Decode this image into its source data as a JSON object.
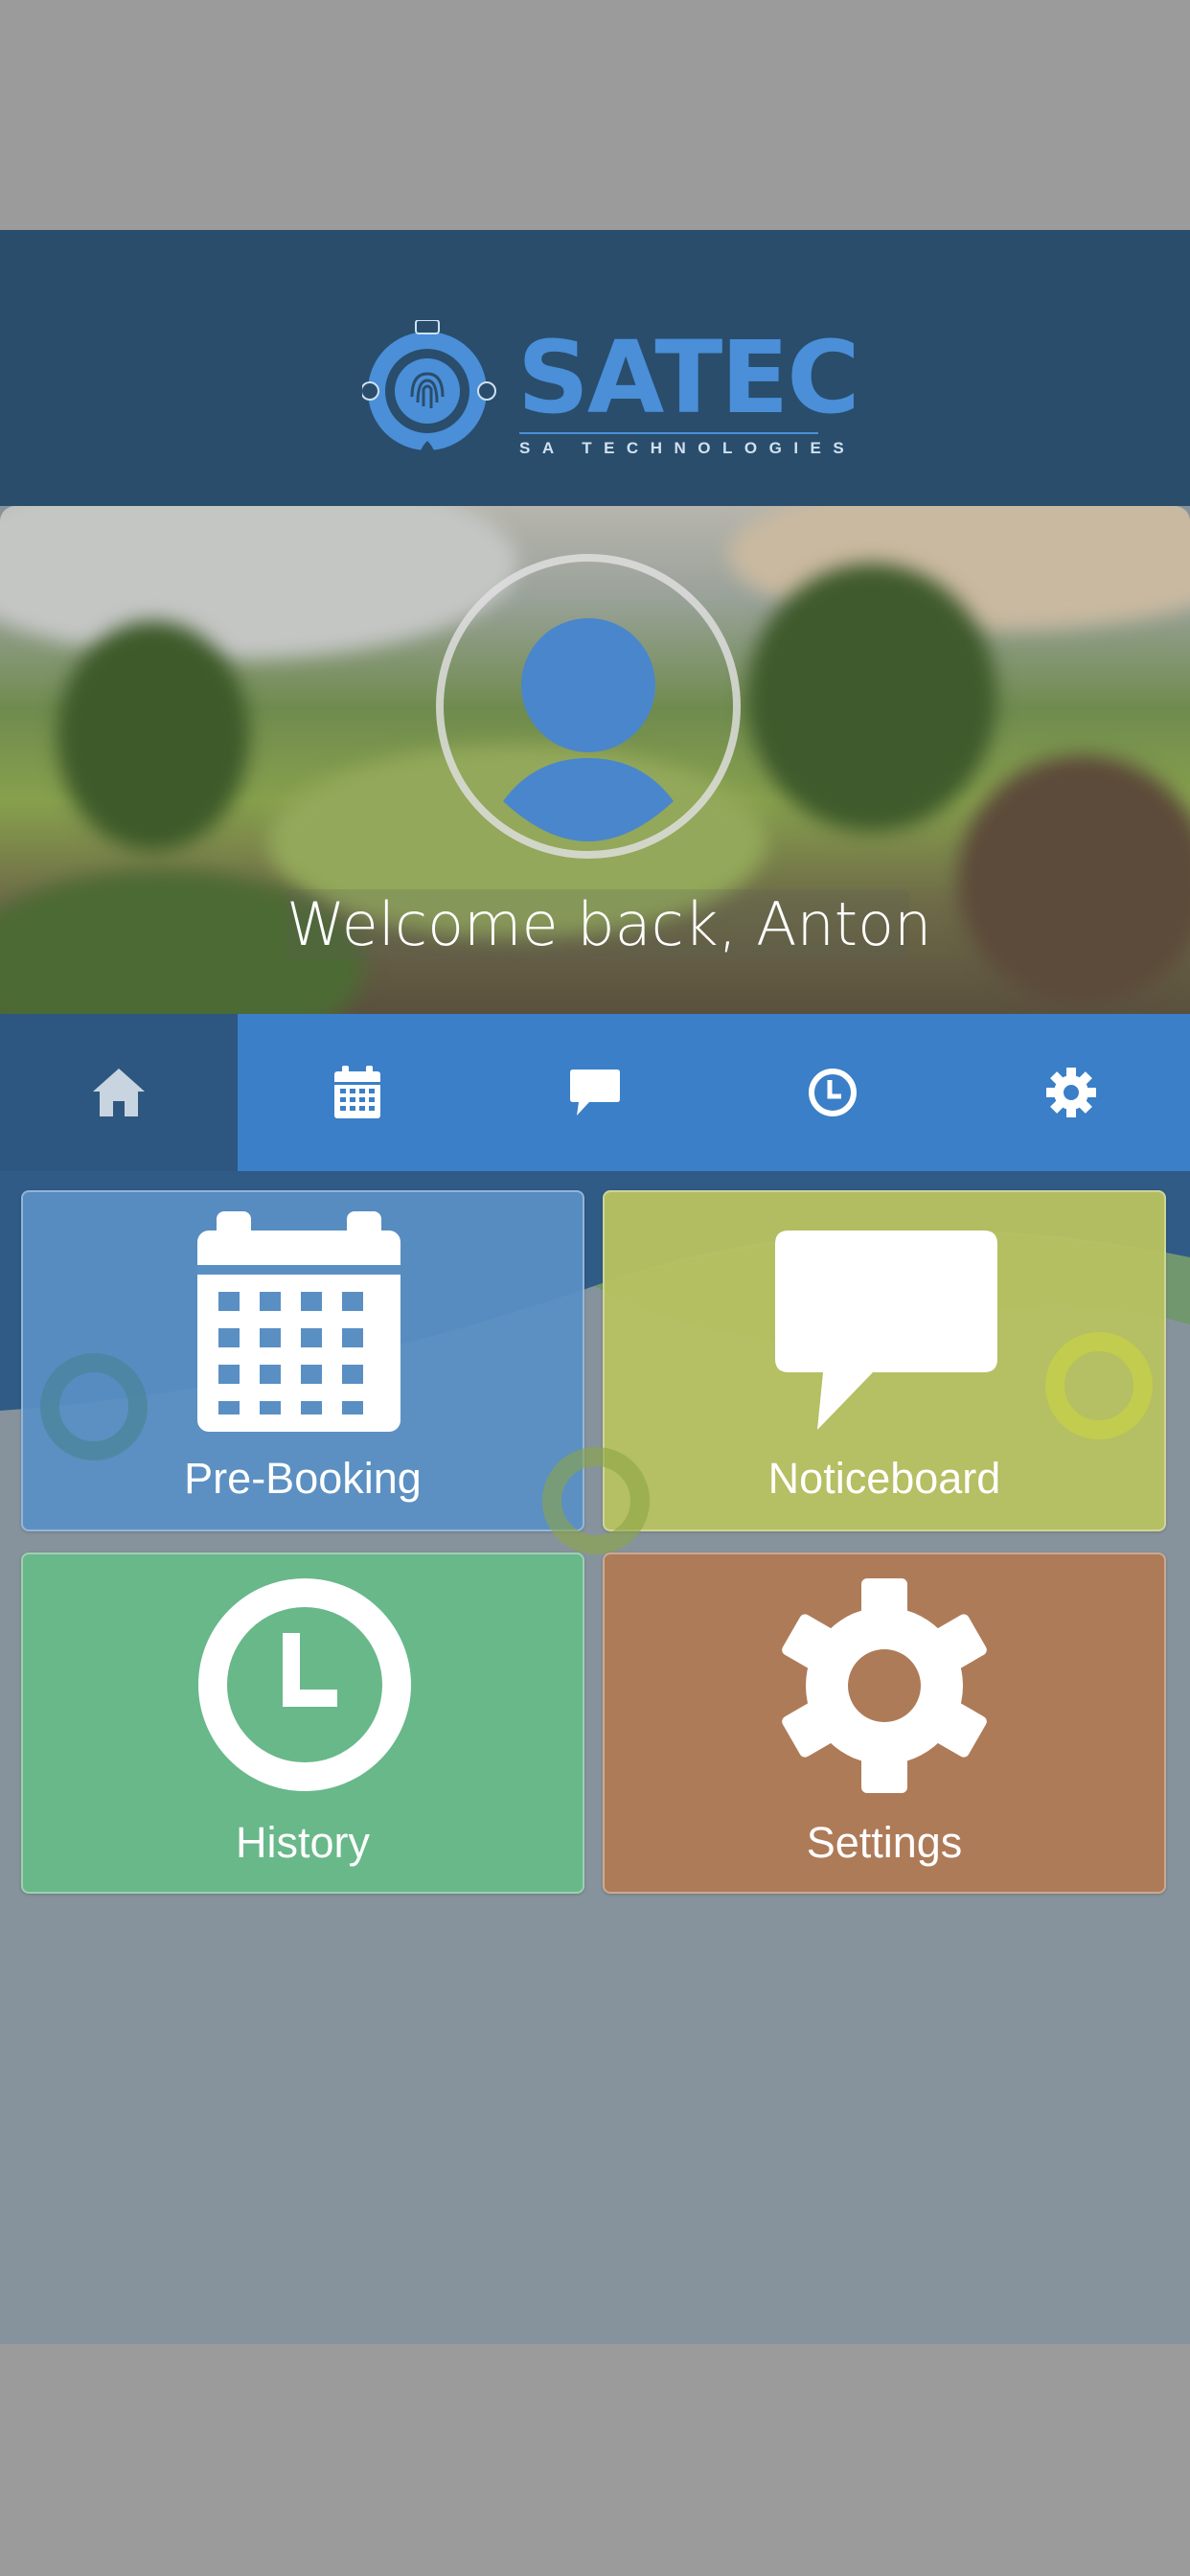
{
  "app": {
    "brand": {
      "name": "SATEC",
      "tagline": "SA TECHNOLOGIES"
    },
    "hero": {
      "welcome": "Welcome back, Anton"
    },
    "nav": {
      "tabs": [
        {
          "icon": "home-icon",
          "active": true
        },
        {
          "icon": "calendar-icon",
          "active": false
        },
        {
          "icon": "chat-bubble-icon",
          "active": false
        },
        {
          "icon": "clock-icon",
          "active": false
        },
        {
          "icon": "gear-icon",
          "active": false
        }
      ]
    },
    "tiles": [
      {
        "label": "Pre-Booking",
        "icon": "calendar-icon",
        "color": "#5a8fc4"
      },
      {
        "label": "Noticeboard",
        "icon": "chat-bubble-icon",
        "color": "#b7c061"
      },
      {
        "label": "History",
        "icon": "clock-icon",
        "color": "#68b88a"
      },
      {
        "label": "Settings",
        "icon": "gear-icon",
        "color": "#ae7b58"
      }
    ]
  },
  "colors": {
    "header": "#2a4d6c",
    "nav": "#3a7fc8",
    "nav_active": "#2d5780",
    "background": "#87939c",
    "outer": "#9b9b9b"
  }
}
